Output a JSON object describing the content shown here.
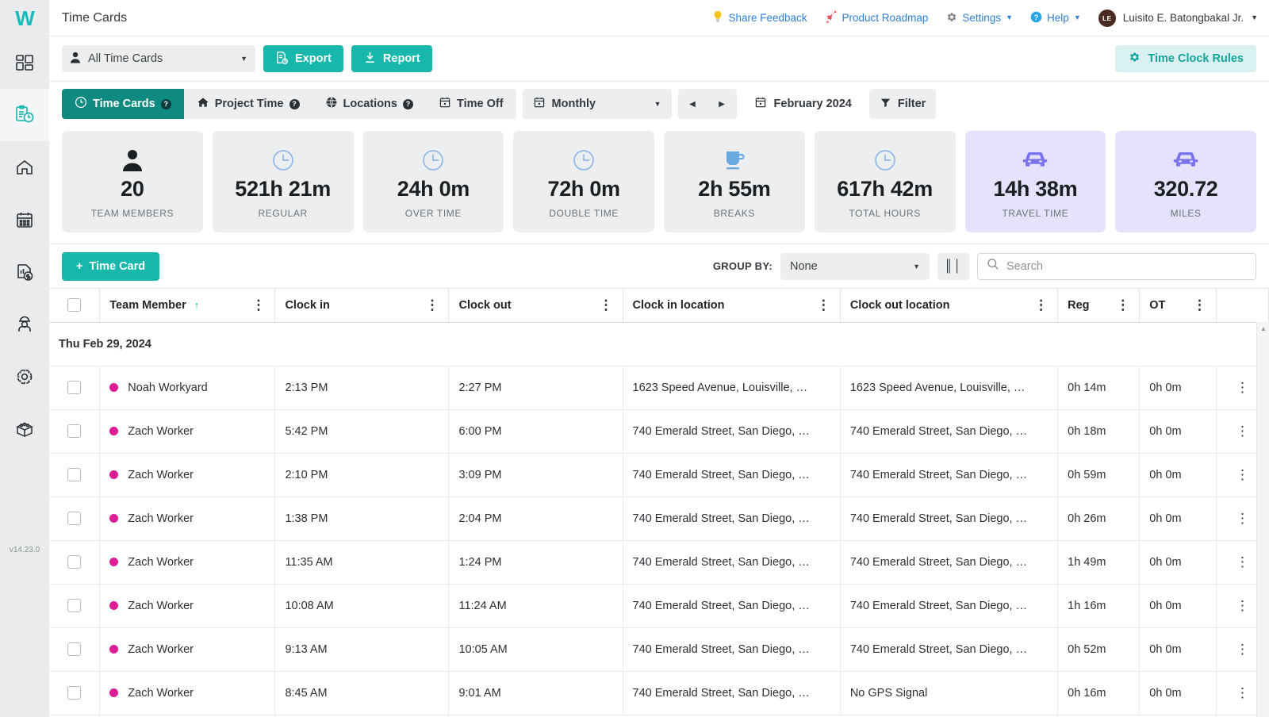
{
  "sidebar": {
    "logo": "W",
    "version": "v14.23.0",
    "items": [
      {
        "icon": "dashboard-icon",
        "name": "dashboard"
      },
      {
        "icon": "time-cards-icon",
        "name": "time-cards"
      },
      {
        "icon": "home-icon",
        "name": "home"
      },
      {
        "icon": "calendar-icon",
        "name": "scheduling"
      },
      {
        "icon": "invoice-icon",
        "name": "invoices"
      },
      {
        "icon": "worker-icon",
        "name": "crew"
      },
      {
        "icon": "gear-cycle-icon",
        "name": "operations"
      },
      {
        "icon": "boxes-icon",
        "name": "inventory"
      }
    ]
  },
  "topbar": {
    "title": "Time Cards",
    "share_feedback": "Share Feedback",
    "product_roadmap": "Product Roadmap",
    "settings": "Settings",
    "help": "Help",
    "user_initials": "LE",
    "user_name": "Luisito E. Batongbakal Jr."
  },
  "actionbar": {
    "filter_select": "All Time Cards",
    "export_label": "Export",
    "report_label": "Report",
    "time_clock_rules": "Time Clock Rules"
  },
  "tabs": [
    {
      "label": "Time Cards",
      "icon": "clock-icon",
      "help": true,
      "active": true
    },
    {
      "label": "Project Time",
      "icon": "home-icon",
      "help": true,
      "active": false
    },
    {
      "label": "Locations",
      "icon": "globe-icon",
      "help": true,
      "active": false
    },
    {
      "label": "Time Off",
      "icon": "calendar-icon",
      "help": false,
      "active": false
    }
  ],
  "periodbar": {
    "period": "Monthly",
    "prev": "◀",
    "next": "▶",
    "date_range": "February 2024",
    "filter": "Filter"
  },
  "stats": [
    {
      "value": "20",
      "label": "TEAM MEMBERS",
      "icon": "person-icon",
      "accent": false
    },
    {
      "value": "521h 21m",
      "label": "REGULAR",
      "icon": "clock-icon",
      "accent": false
    },
    {
      "value": "24h 0m",
      "label": "OVER TIME",
      "icon": "clock-icon",
      "accent": false
    },
    {
      "value": "72h 0m",
      "label": "DOUBLE TIME",
      "icon": "clock-icon",
      "accent": false
    },
    {
      "value": "2h 55m",
      "label": "BREAKS",
      "icon": "coffee-icon",
      "accent": false
    },
    {
      "value": "617h 42m",
      "label": "TOTAL HOURS",
      "icon": "clock-icon",
      "accent": false
    },
    {
      "value": "14h 38m",
      "label": "TRAVEL TIME",
      "icon": "car-icon",
      "accent": true
    },
    {
      "value": "320.72",
      "label": "MILES",
      "icon": "car-icon",
      "accent": true
    }
  ],
  "tabletoolbar": {
    "add_time_card": "Time Card",
    "add_icon": "+",
    "group_by_label": "GROUP BY:",
    "group_by_value": "None",
    "columns_icon": "columns-icon",
    "search_placeholder": "Search"
  },
  "table": {
    "columns": [
      {
        "label": "Team Member",
        "sorted": true,
        "sort_dir": "↑"
      },
      {
        "label": "Clock in",
        "sorted": false
      },
      {
        "label": "Clock out",
        "sorted": false
      },
      {
        "label": "Clock in location",
        "sorted": false
      },
      {
        "label": "Clock out location",
        "sorted": false
      },
      {
        "label": "Reg",
        "sorted": false
      },
      {
        "label": "OT",
        "sorted": false
      }
    ],
    "group_label": "Thu Feb 29, 2024",
    "rows": [
      {
        "member": "Noah Workyard",
        "clock_in": "2:13 PM",
        "clock_out": "2:27 PM",
        "in_loc": "1623 Speed Avenue, Louisville, …",
        "out_loc": "1623 Speed Avenue, Louisville, …",
        "reg": "0h 14m",
        "ot": "0h 0m"
      },
      {
        "member": "Zach Worker",
        "clock_in": "5:42 PM",
        "clock_out": "6:00 PM",
        "in_loc": "740 Emerald Street, San Diego, …",
        "out_loc": "740 Emerald Street, San Diego, …",
        "reg": "0h 18m",
        "ot": "0h 0m"
      },
      {
        "member": "Zach Worker",
        "clock_in": "2:10 PM",
        "clock_out": "3:09 PM",
        "in_loc": "740 Emerald Street, San Diego, …",
        "out_loc": "740 Emerald Street, San Diego, …",
        "reg": "0h 59m",
        "ot": "0h 0m"
      },
      {
        "member": "Zach Worker",
        "clock_in": "1:38 PM",
        "clock_out": "2:04 PM",
        "in_loc": "740 Emerald Street, San Diego, …",
        "out_loc": "740 Emerald Street, San Diego, …",
        "reg": "0h 26m",
        "ot": "0h 0m"
      },
      {
        "member": "Zach Worker",
        "clock_in": "11:35 AM",
        "clock_out": "1:24 PM",
        "in_loc": "740 Emerald Street, San Diego, …",
        "out_loc": "740 Emerald Street, San Diego, …",
        "reg": "1h 49m",
        "ot": "0h 0m"
      },
      {
        "member": "Zach Worker",
        "clock_in": "10:08 AM",
        "clock_out": "11:24 AM",
        "in_loc": "740 Emerald Street, San Diego, …",
        "out_loc": "740 Emerald Street, San Diego, …",
        "reg": "1h 16m",
        "ot": "0h 0m"
      },
      {
        "member": "Zach Worker",
        "clock_in": "9:13 AM",
        "clock_out": "10:05 AM",
        "in_loc": "740 Emerald Street, San Diego, …",
        "out_loc": "740 Emerald Street, San Diego, …",
        "reg": "0h 52m",
        "ot": "0h 0m"
      },
      {
        "member": "Zach Worker",
        "clock_in": "8:45 AM",
        "clock_out": "9:01 AM",
        "in_loc": "740 Emerald Street, San Diego, …",
        "out_loc": "No GPS Signal",
        "reg": "0h 16m",
        "ot": "0h 0m"
      }
    ]
  },
  "colors": {
    "teal": "#17b8ab",
    "teal_dark": "#0f8a80",
    "link_blue": "#2f7fd4",
    "dot_pink": "#dd1d94",
    "accent_card": "#e4e3fb",
    "car_purple": "#7a74ef",
    "clock_blue": "#8fb8e8"
  }
}
